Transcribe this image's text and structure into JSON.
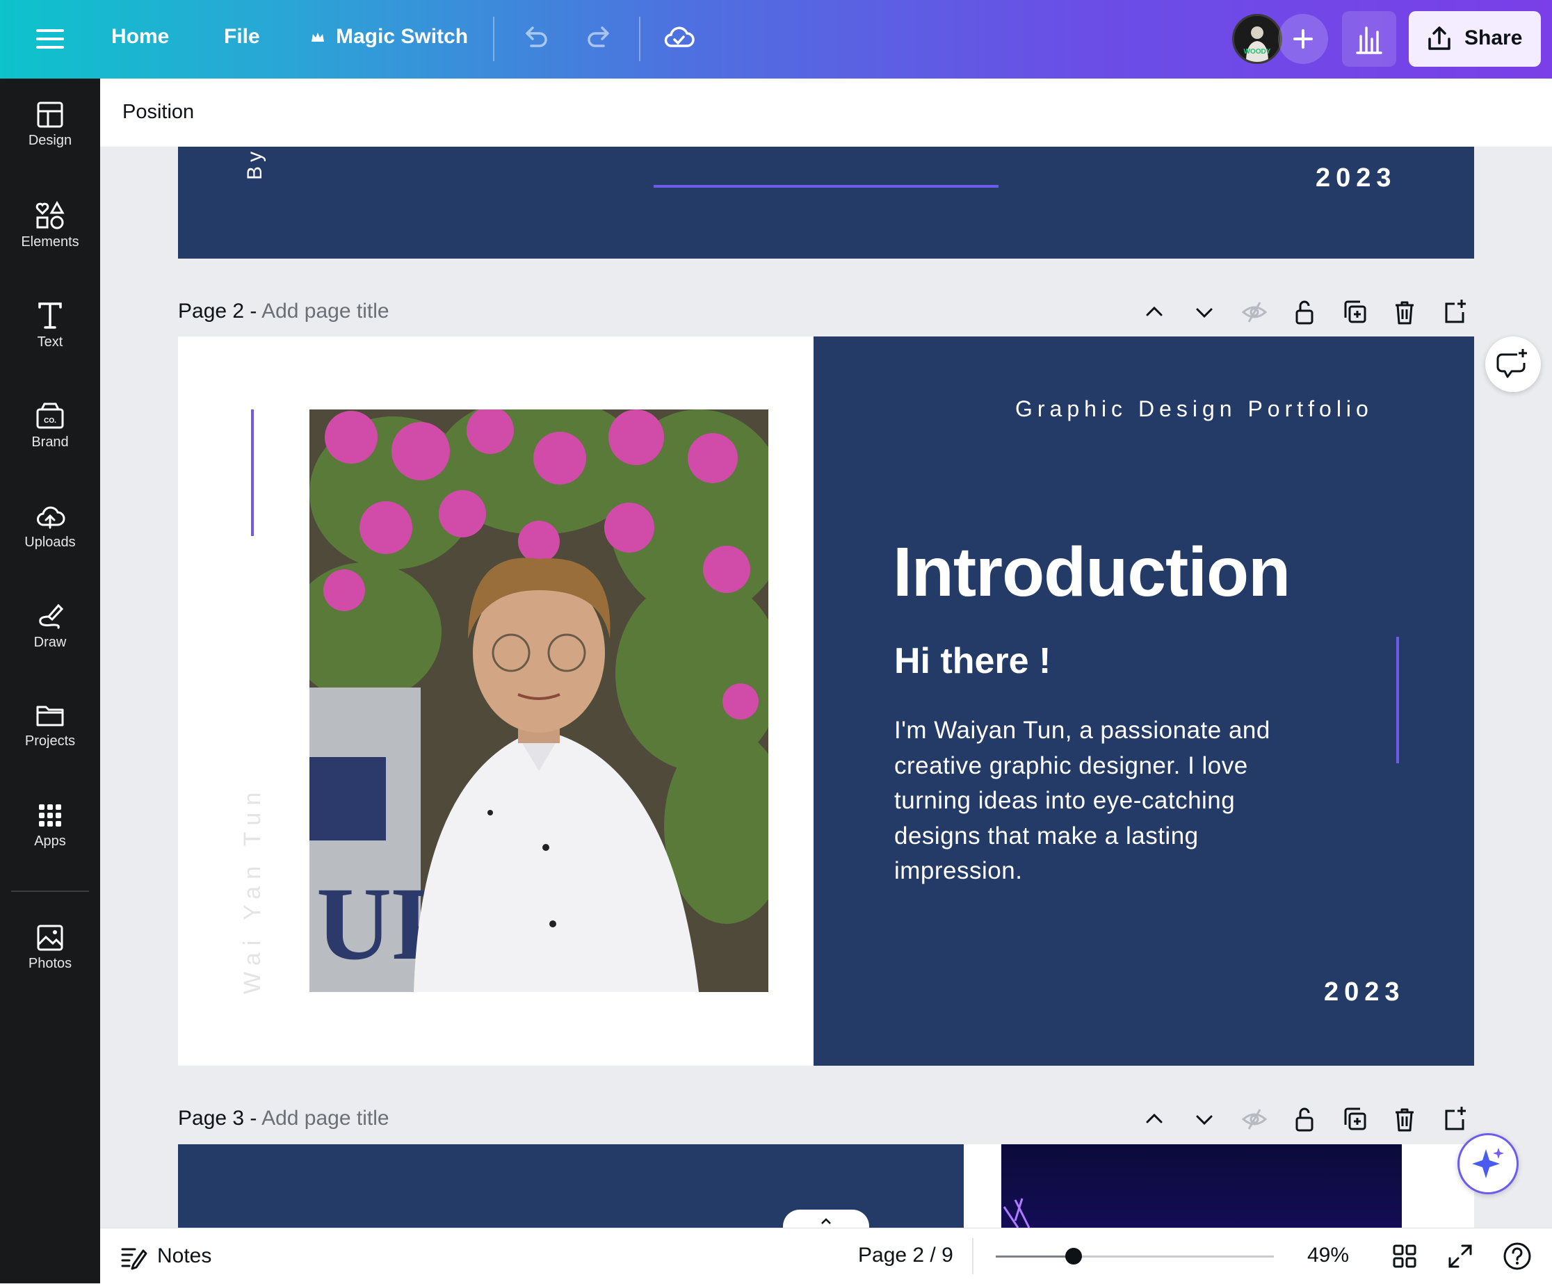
{
  "topbar": {
    "home": "Home",
    "file": "File",
    "magic_switch": "Magic Switch",
    "share": "Share",
    "avatar_text": "WOODY"
  },
  "sidebar": {
    "items": [
      {
        "label": "Design",
        "icon": "design-icon"
      },
      {
        "label": "Elements",
        "icon": "elements-icon"
      },
      {
        "label": "Text",
        "icon": "text-icon"
      },
      {
        "label": "Brand",
        "icon": "brand-icon",
        "badge": "CO."
      },
      {
        "label": "Uploads",
        "icon": "upload-icon"
      },
      {
        "label": "Draw",
        "icon": "draw-icon"
      },
      {
        "label": "Projects",
        "icon": "folder-icon"
      },
      {
        "label": "Apps",
        "icon": "apps-icon"
      },
      {
        "label": "Photos",
        "icon": "photos-icon"
      }
    ]
  },
  "panel": {
    "title": "Position"
  },
  "page1": {
    "by_text": "By",
    "year": "2023"
  },
  "page2": {
    "label": "Page 2 - ",
    "title_placeholder": "Add page title",
    "heading_small": "Graphic Design Portfolio",
    "title": "Introduction",
    "greeting": "Hi there !",
    "body": [
      "I'm Waiyan Tun, a passionate and",
      "creative graphic designer. I love",
      "turning ideas into eye-catching",
      "designs that make a lasting",
      "impression."
    ],
    "vertical_name": "Wai Yan Tun",
    "year": "2023"
  },
  "page3": {
    "label": "Page 3 - ",
    "title_placeholder": "Add page title"
  },
  "bottombar": {
    "notes": "Notes",
    "page_indicator": "Page 2 / 9",
    "zoom": "49%",
    "zoom_level": 0.49
  },
  "colors": {
    "slide_navy": "#243a67",
    "accent_purple": "#6c5ce7",
    "gradient_start": "#0dc3cc",
    "gradient_end": "#7a3fe8"
  }
}
